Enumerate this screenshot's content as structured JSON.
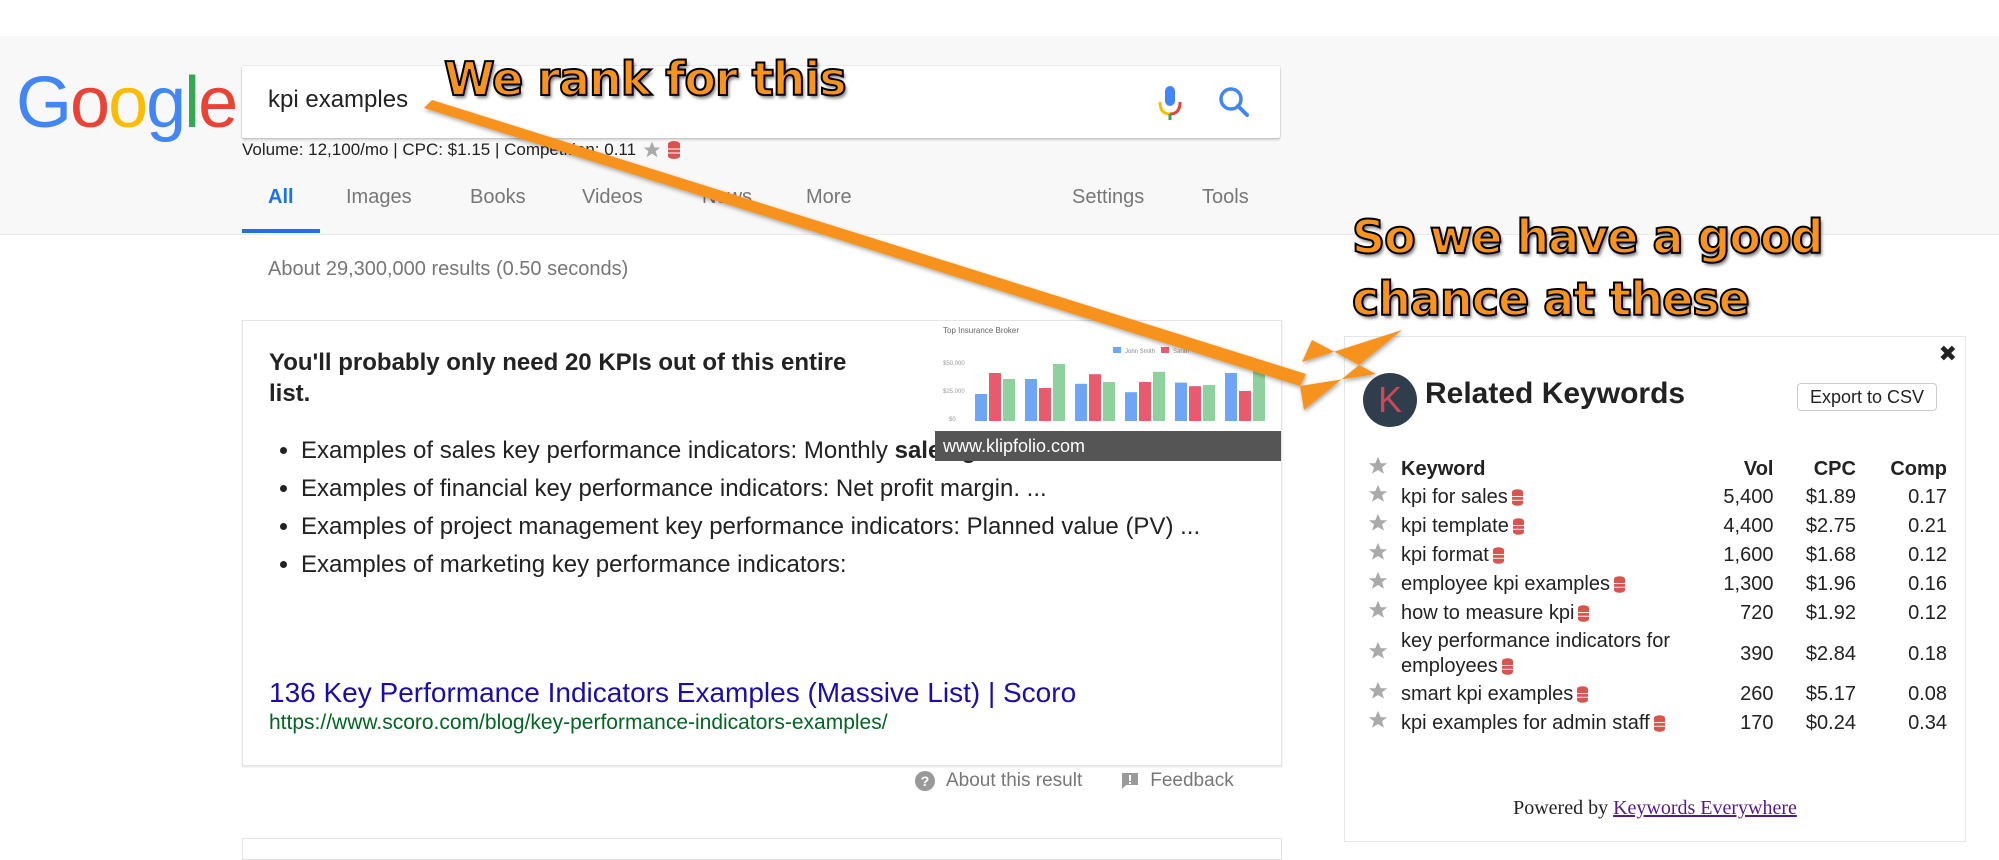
{
  "logo": {
    "letters": [
      "G",
      "o",
      "o",
      "g",
      "l",
      "e"
    ],
    "colors": [
      "#4285f4",
      "#ea4335",
      "#fbbc05",
      "#4285f4",
      "#34a853",
      "#ea4335"
    ]
  },
  "search": {
    "query": "kpi examples",
    "mic_icon": "microphone-icon",
    "search_icon": "magnifier-icon"
  },
  "ke_stats": {
    "text": "Volume: 12,100/mo | CPC: $1.15 | Competition: 0.11"
  },
  "tabs": [
    {
      "label": "All",
      "active": true
    },
    {
      "label": "Images"
    },
    {
      "label": "Books"
    },
    {
      "label": "Videos"
    },
    {
      "label": "News"
    },
    {
      "label": "More"
    },
    {
      "label": "Settings"
    },
    {
      "label": "Tools"
    }
  ],
  "result_stats": "About 29,300,000 results (0.50 seconds)",
  "featured_snippet": {
    "title": "You'll probably only need 20 KPIs out of this entire list.",
    "bullets": [
      {
        "before": "Examples of sales key performance indicators: Monthly ",
        "bold": "sales growth",
        "after": ". ..."
      },
      {
        "before": "Examples of financial key performance indicators: Net profit margin. ...",
        "bold": "",
        "after": ""
      },
      {
        "before": "Examples of project management key performance indicators: Planned value (PV) ...",
        "bold": "",
        "after": ""
      },
      {
        "before": "Examples of marketing key performance indicators:",
        "bold": "",
        "after": ""
      }
    ],
    "image": {
      "chart_title": "Top Insurance Broker",
      "legend": [
        "John Smith",
        "Sarah"
      ],
      "y_ticks": [
        "$50,000",
        "$25,000",
        "$0"
      ],
      "caption": "www.klipfolio.com"
    },
    "link_title": "136 Key Performance Indicators Examples (Massive List) | Scoro",
    "url": "https://www.scoro.com/blog/key-performance-indicators-examples/"
  },
  "card_footer": {
    "about": "About this result",
    "feedback": "Feedback"
  },
  "annotations": {
    "top": "We rank for this",
    "right_line1": "So we have a good",
    "right_line2": "chance at these"
  },
  "related_keywords": {
    "title": "Related Keywords",
    "export_label": "Export to CSV",
    "close_icon": "✖",
    "logo_letter": "K",
    "columns": {
      "keyword": "Keyword",
      "vol": "Vol",
      "cpc": "CPC",
      "comp": "Comp"
    },
    "rows": [
      {
        "keyword": "kpi for sales",
        "vol": "5,400",
        "cpc": "$1.89",
        "comp": "0.17"
      },
      {
        "keyword": "kpi template",
        "vol": "4,400",
        "cpc": "$2.75",
        "comp": "0.21"
      },
      {
        "keyword": "kpi format",
        "vol": "1,600",
        "cpc": "$1.68",
        "comp": "0.12"
      },
      {
        "keyword": "employee kpi examples",
        "vol": "1,300",
        "cpc": "$1.96",
        "comp": "0.16"
      },
      {
        "keyword": "how to measure kpi",
        "vol": "720",
        "cpc": "$1.92",
        "comp": "0.12"
      },
      {
        "keyword": "key performance indicators for employees",
        "vol": "390",
        "cpc": "$2.84",
        "comp": "0.18"
      },
      {
        "keyword": "smart kpi examples",
        "vol": "260",
        "cpc": "$5.17",
        "comp": "0.08"
      },
      {
        "keyword": "kpi examples for admin staff",
        "vol": "170",
        "cpc": "$0.24",
        "comp": "0.34"
      }
    ],
    "powered_prefix": "Powered by ",
    "powered_link": "Keywords Everywhere"
  },
  "colors": {
    "accent": "#1a73e8",
    "link": "#1a0dab",
    "url": "#006621",
    "annotation": "#f7931e",
    "db_icon": "#d9534f"
  }
}
